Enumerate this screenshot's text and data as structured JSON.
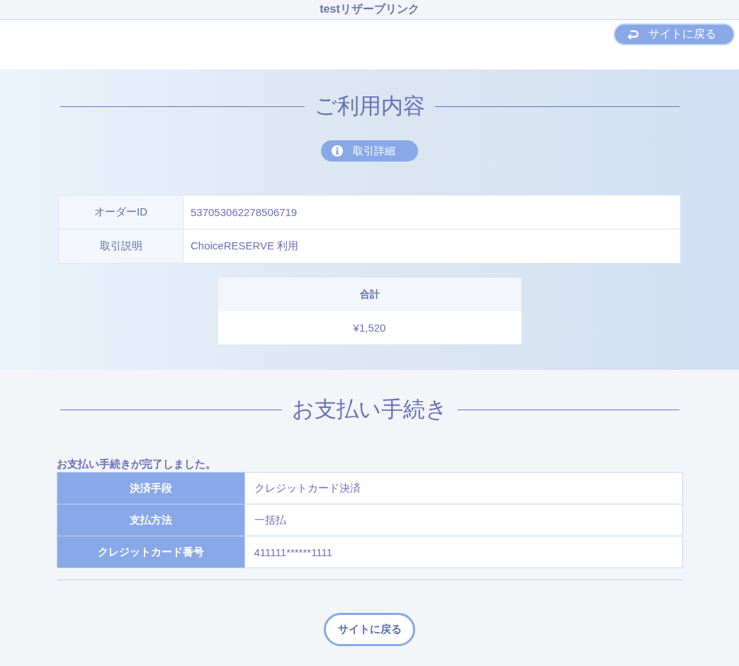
{
  "header": {
    "title": "testリザーブリンク"
  },
  "top_actions": {
    "back_button": "サイトに戻る"
  },
  "usage_section": {
    "heading": "ご利用内容",
    "details_button": "取引詳細",
    "rows": [
      {
        "label": "オーダーID",
        "value": "537053062278506719"
      },
      {
        "label": "取引説明",
        "value": "ChoiceRESERVE 利用"
      }
    ],
    "total": {
      "label": "合計",
      "value": "¥1,520"
    }
  },
  "payment_section": {
    "heading": "お支払い手続き",
    "message": "お支払い手続きが完了しました。",
    "rows": [
      {
        "label": "決済手段",
        "value": "クレジットカード決済"
      },
      {
        "label": "支払方法",
        "value": "一括払"
      },
      {
        "label": "クレジットカード番号",
        "value": "411111******1111"
      }
    ]
  },
  "footer": {
    "back_button": "サイトに戻る"
  }
}
